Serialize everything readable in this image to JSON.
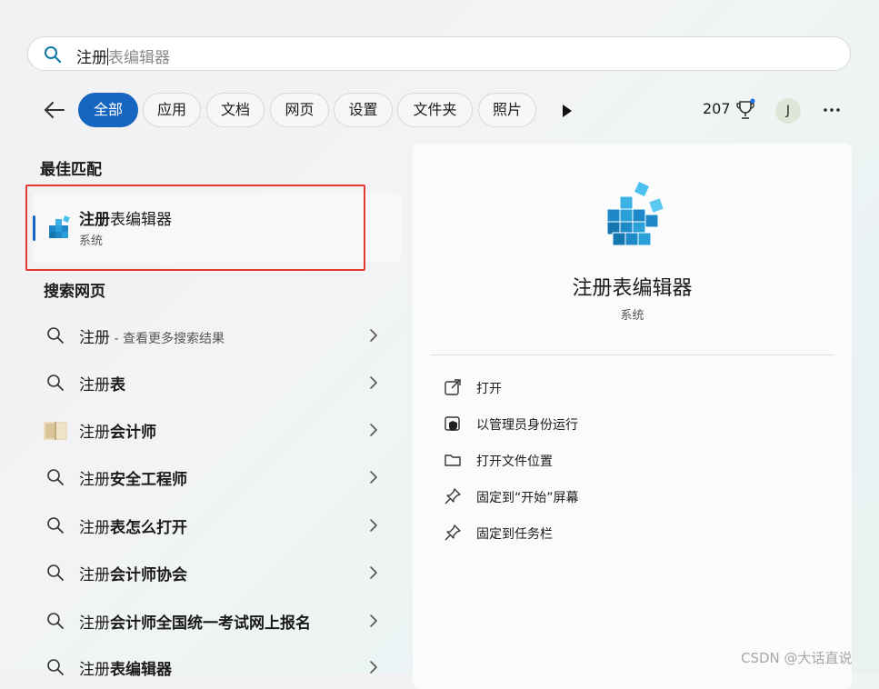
{
  "search": {
    "typed": "注册",
    "suggestion": "表编辑器"
  },
  "filters": {
    "back_icon": "arrow-left-icon",
    "items": [
      "全部",
      "应用",
      "文档",
      "网页",
      "设置",
      "文件夹",
      "照片"
    ],
    "active_index": 0,
    "play_icon": "play-icon"
  },
  "header_right": {
    "points": "207",
    "trophy_icon": "trophy-icon",
    "avatar_letter": "J",
    "more_icon": "ellipsis-icon"
  },
  "best_match": {
    "section_title": "最佳匹配",
    "app_name_bold": "注册",
    "app_name_rest": "表编辑器",
    "app_category": "系统",
    "app_icon": "registry-editor-icon"
  },
  "web_search": {
    "section_title": "搜索网页",
    "items": [
      {
        "prefix": "注册",
        "bold": "",
        "hint": " - 查看更多搜索结果",
        "icon": "search-icon"
      },
      {
        "prefix": "注册",
        "bold": "表",
        "hint": "",
        "icon": "search-icon"
      },
      {
        "prefix": "注册",
        "bold": "会计师",
        "hint": "",
        "icon": "book-thumbnail-icon"
      },
      {
        "prefix": "注册",
        "bold": "安全工程师",
        "hint": "",
        "icon": "search-icon"
      },
      {
        "prefix": "注册",
        "bold": "表怎么打开",
        "hint": "",
        "icon": "search-icon"
      },
      {
        "prefix": "注册",
        "bold": "会计师协会",
        "hint": "",
        "icon": "search-icon"
      },
      {
        "prefix": "注册",
        "bold": "会计师全国统一考试网上报名",
        "hint": "",
        "icon": "search-icon"
      },
      {
        "prefix": "注册",
        "bold": "表编辑器",
        "hint": "",
        "icon": "search-icon"
      }
    ]
  },
  "detail": {
    "title": "注册表编辑器",
    "subtitle": "系统",
    "actions": [
      {
        "label": "打开",
        "icon": "open-external-icon"
      },
      {
        "label": "以管理员身份运行",
        "icon": "shield-icon"
      },
      {
        "label": "打开文件位置",
        "icon": "folder-icon"
      },
      {
        "label": "固定到“开始”屏幕",
        "icon": "pin-icon"
      },
      {
        "label": "固定到任务栏",
        "icon": "pin-icon"
      }
    ]
  },
  "watermark": "CSDN @大话直说",
  "colors": {
    "accent": "#1665c0",
    "highlight_border": "#e53935"
  }
}
